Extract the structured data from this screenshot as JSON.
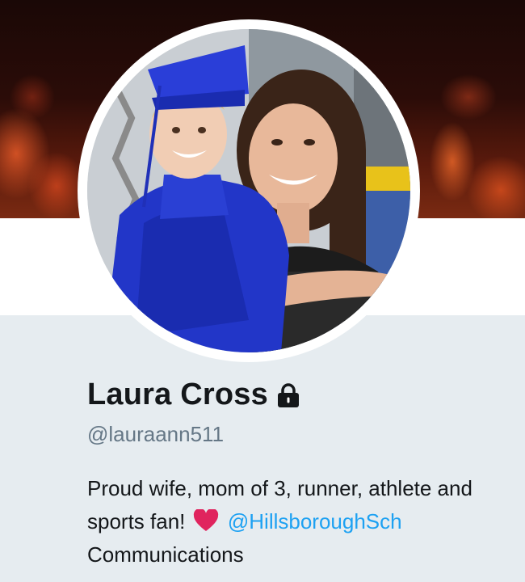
{
  "profile": {
    "name": "Laura Cross",
    "handle": "@lauraann511",
    "protected_icon": "lock-icon",
    "bio": {
      "line1": "Proud wife, mom of 3, runner, athlete and",
      "line2_prefix": "sports fan!",
      "emoji": "heart-icon",
      "mention": "@HillsboroughSch",
      "line3": "Communications"
    }
  },
  "colors": {
    "header_bg": "#e6ecf0",
    "name": "#14171a",
    "handle": "#657786",
    "link": "#1da1f2",
    "heart": "#e0245e"
  }
}
